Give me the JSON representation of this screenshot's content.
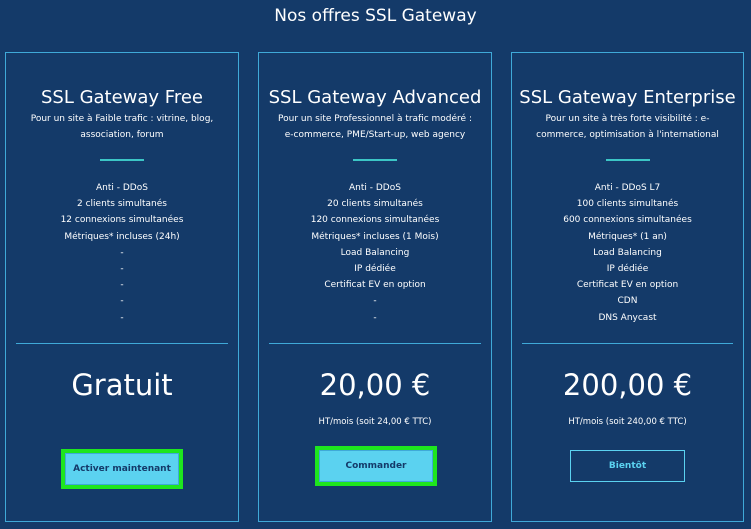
{
  "page": {
    "title": "Nos offres SSL Gateway"
  },
  "colors": {
    "background": "#143a69",
    "border": "#3fa9d8",
    "accent": "#3cc6c6",
    "button": "#5bd2f0",
    "highlight": "#1ee61e"
  },
  "offers": [
    {
      "name": "SSL Gateway Free",
      "description": "Pour un site à Faible trafic : vitrine, blog, association, forum",
      "features": [
        "Anti - DDoS",
        "2 clients simultanés",
        "12 connexions simultanées",
        "Métriques* incluses (24h)",
        "-",
        "-",
        "-",
        "-",
        "-"
      ],
      "price": "Gratuit",
      "price_note": "",
      "button_label": "Activer maintenant"
    },
    {
      "name": "SSL Gateway Advanced",
      "description": "Pour un site Professionnel à trafic modéré : e-commerce, PME/Start-up, web agency",
      "features": [
        "Anti - DDoS",
        "20 clients simultanés",
        "120 connexions simultanées",
        "Métriques* incluses (1 Mois)",
        "Load Balancing",
        "IP dédiée",
        "Certificat EV en option",
        "-",
        "-"
      ],
      "price": "20,00 €",
      "price_note": "HT/mois (soit 24,00 € TTC)",
      "button_label": "Commander"
    },
    {
      "name": "SSL Gateway Enterprise",
      "description": "Pour un site à très forte visibilité : e-commerce, optimisation à l'international",
      "features": [
        "Anti - DDoS L7",
        "100 clients simultanés",
        "600 connexions simultanées",
        "Métriques* (1 an)",
        "Load Balancing",
        "IP dédiée",
        "Certificat EV en option",
        "CDN",
        "DNS Anycast"
      ],
      "price": "200,00 €",
      "price_note": "HT/mois (soit 240,00 € TTC)",
      "button_label": "Bientôt"
    }
  ]
}
